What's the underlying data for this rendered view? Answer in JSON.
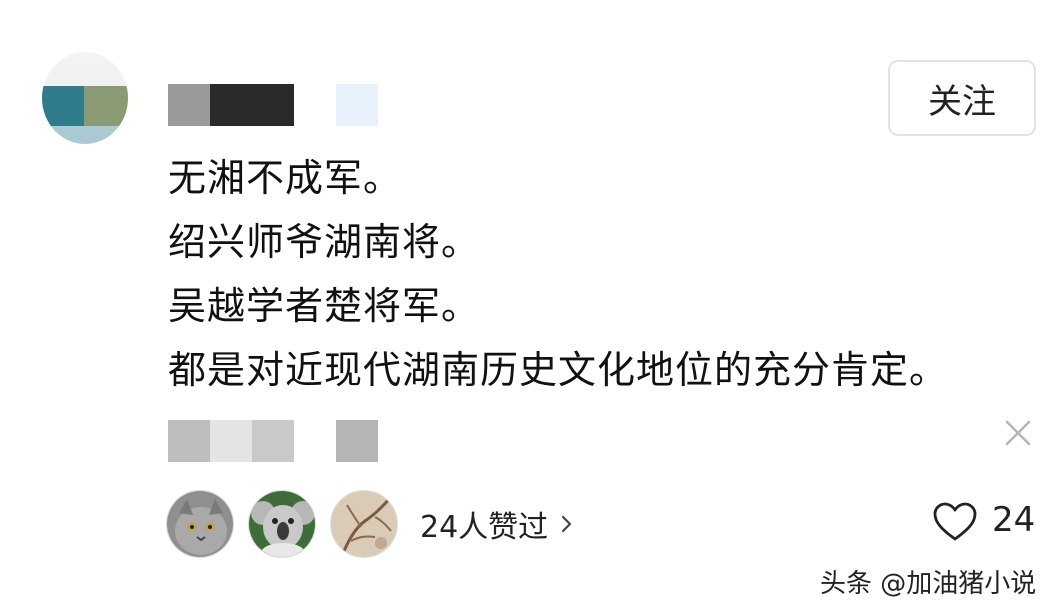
{
  "header": {
    "follow_label": "关注"
  },
  "comment": {
    "lines": [
      "无湘不成军。",
      "绍兴师爷湖南将。",
      "吴越学者楚将军。",
      "都是对近现代湖南历史文化地位的充分肯定。"
    ]
  },
  "likes": {
    "summary": "24人赞过",
    "count": "24"
  },
  "watermark": "头条 @加油猪小说",
  "icons": [
    "close-icon",
    "chevron-right-icon",
    "heart-icon"
  ]
}
